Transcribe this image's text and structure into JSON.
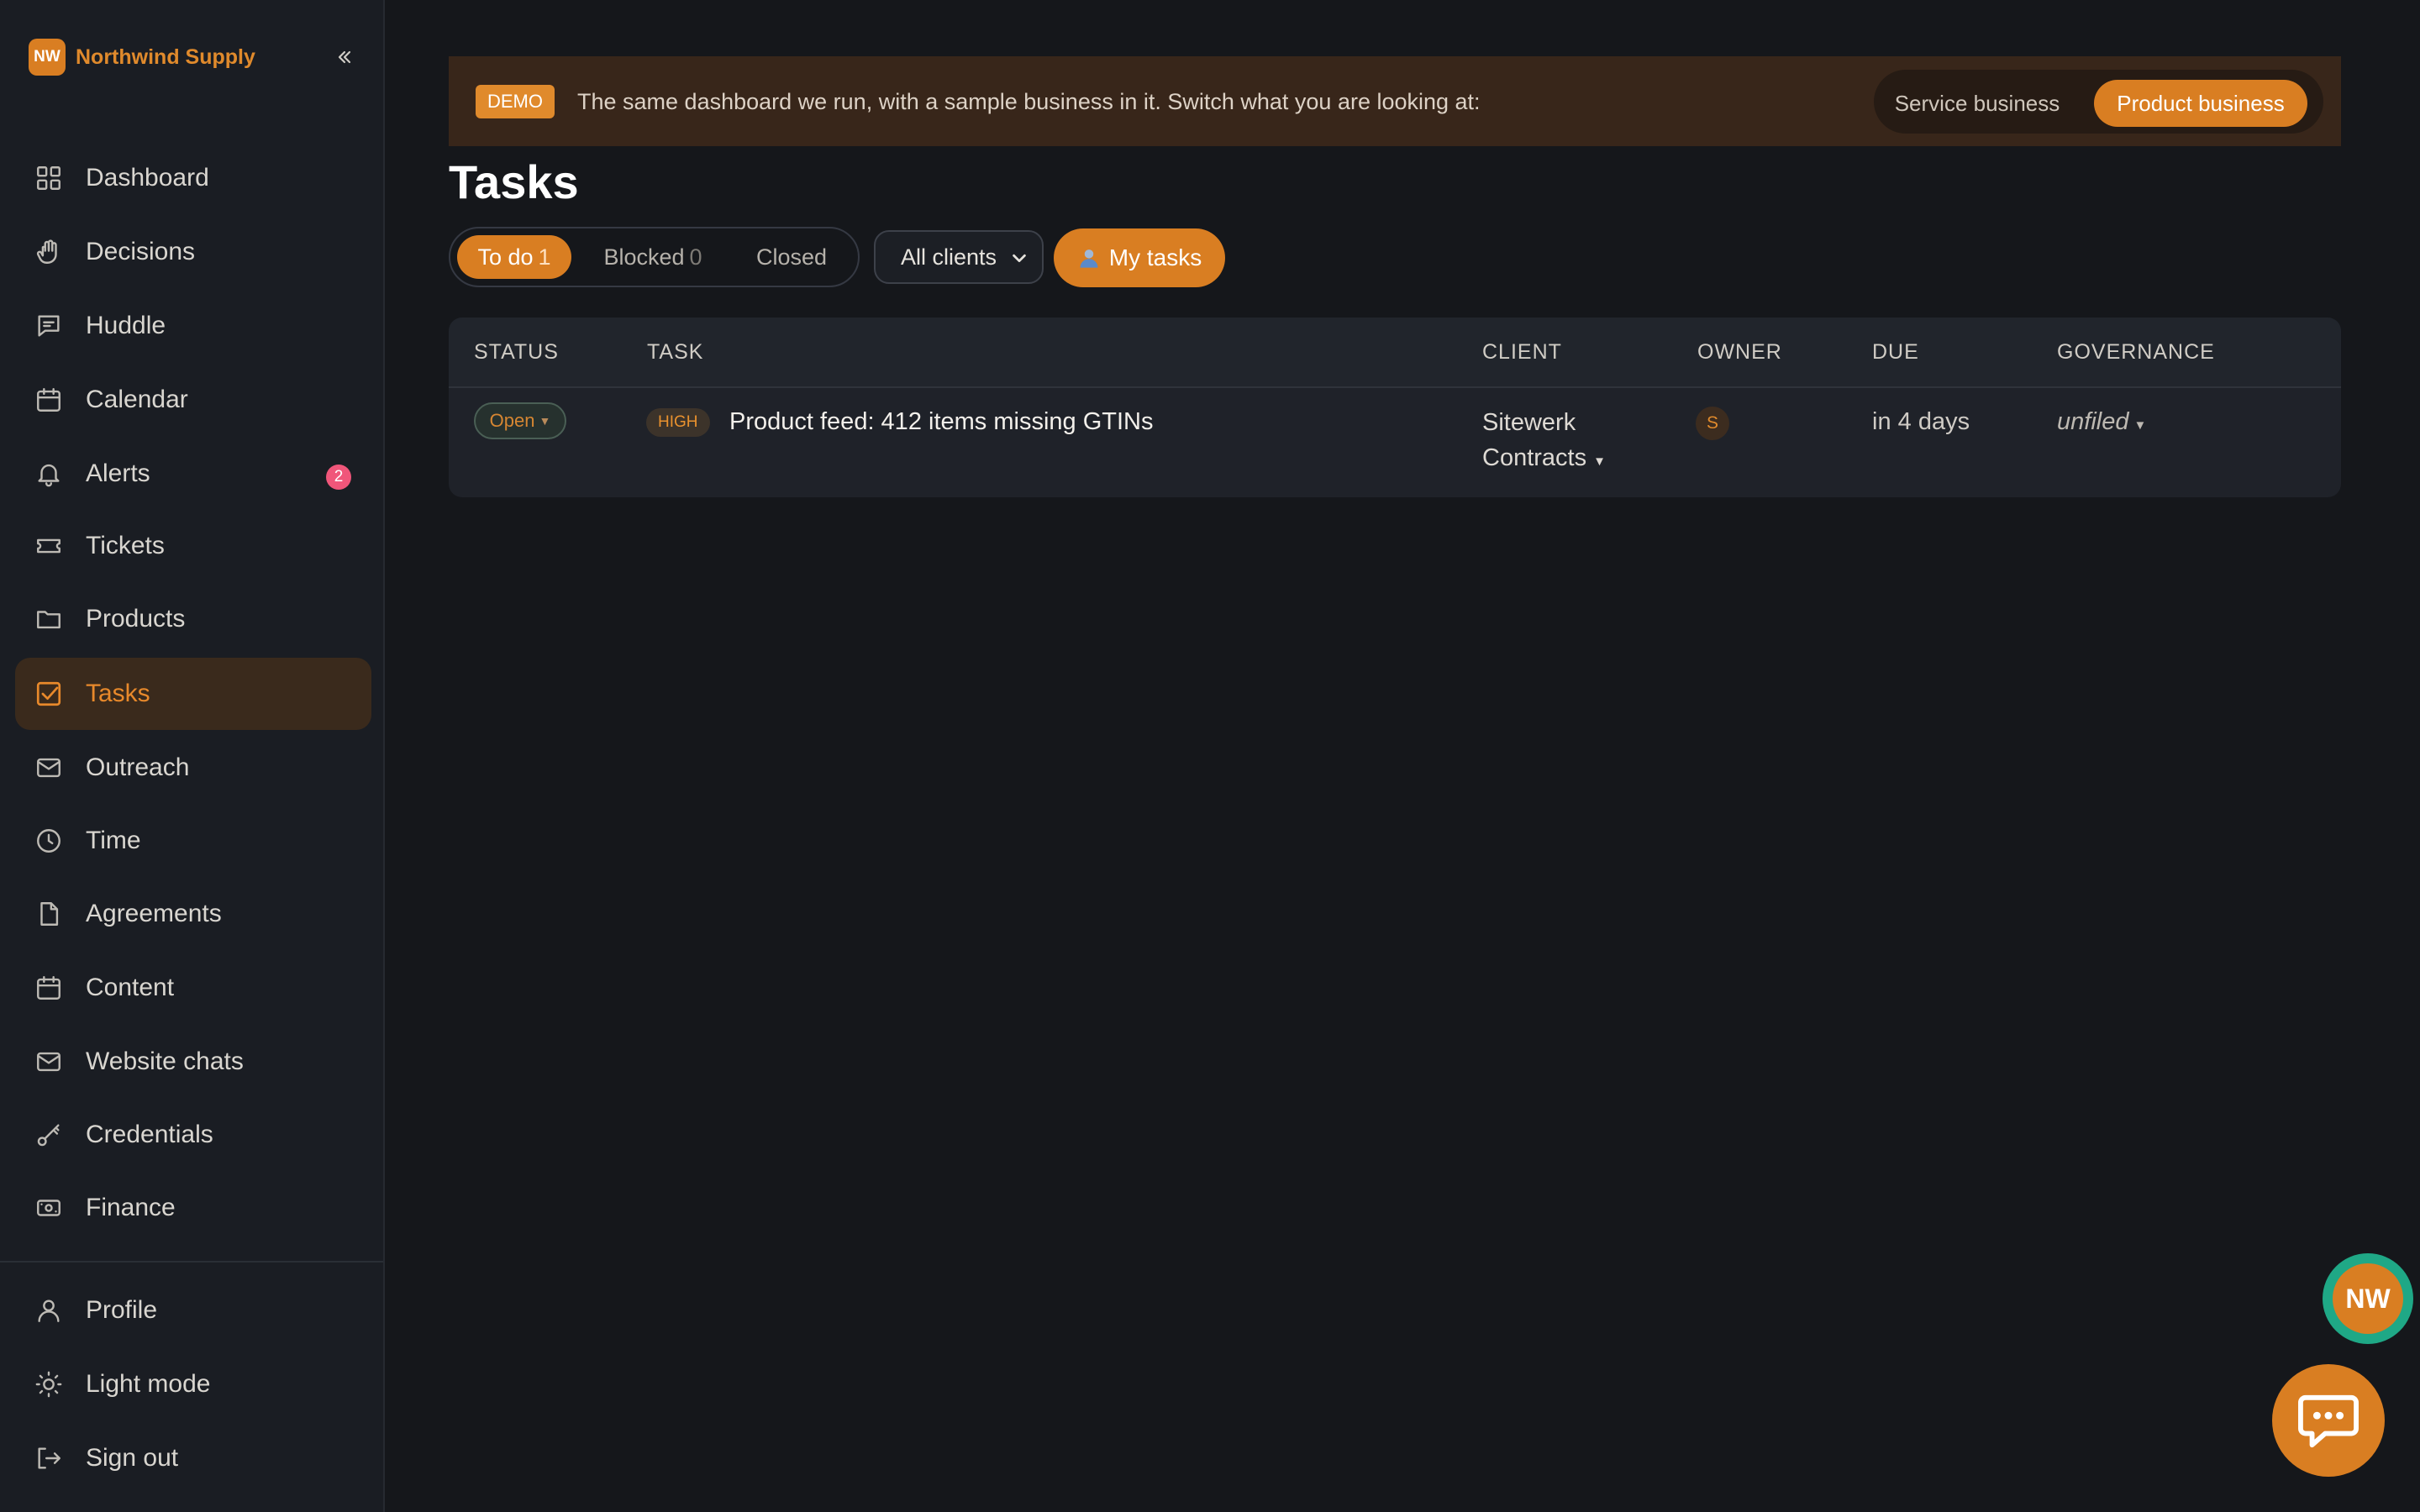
{
  "brand": {
    "logo_text": "NW",
    "name": "Northwind Supply"
  },
  "sidebar": {
    "items": [
      {
        "label": "Dashboard"
      },
      {
        "label": "Decisions"
      },
      {
        "label": "Huddle"
      },
      {
        "label": "Calendar"
      },
      {
        "label": "Alerts",
        "badge": "2"
      },
      {
        "label": "Tickets"
      },
      {
        "label": "Products"
      },
      {
        "label": "Tasks",
        "active": true
      },
      {
        "label": "Outreach"
      },
      {
        "label": "Time"
      },
      {
        "label": "Agreements"
      },
      {
        "label": "Content"
      },
      {
        "label": "Website chats"
      },
      {
        "label": "Credentials"
      },
      {
        "label": "Finance"
      }
    ],
    "footer_items": [
      {
        "label": "Profile"
      },
      {
        "label": "Light mode"
      },
      {
        "label": "Sign out"
      }
    ]
  },
  "demo_banner": {
    "tag": "DEMO",
    "text": "The same dashboard we run, with a sample business in it. Switch what you are looking at:",
    "service_label": "Service business",
    "product_label": "Product business",
    "selected": "Product business"
  },
  "page": {
    "title": "Tasks"
  },
  "filters": {
    "tabs": [
      {
        "label": "To do",
        "count": "1",
        "active": true
      },
      {
        "label": "Blocked",
        "count": "0"
      },
      {
        "label": "Closed",
        "count": ""
      }
    ],
    "client_select": "All clients",
    "my_tasks": "My tasks"
  },
  "table": {
    "headers": [
      "STATUS",
      "TASK",
      "CLIENT",
      "OWNER",
      "DUE",
      "GOVERNANCE"
    ],
    "rows": [
      {
        "status": "Open",
        "priority": "HIGH",
        "task": "Product feed: 412 items missing GTINs",
        "client": "Sitewerk Contracts",
        "owner": "S",
        "due": "in 4 days",
        "governance": "unfiled"
      }
    ]
  },
  "floating": {
    "avatar": "NW"
  },
  "colors": {
    "accent": "#d97e22",
    "background": "#15171b",
    "sidebar": "#1a1d23",
    "alert_badge": "#f0567a",
    "avatar_ring": "#1fa886"
  }
}
